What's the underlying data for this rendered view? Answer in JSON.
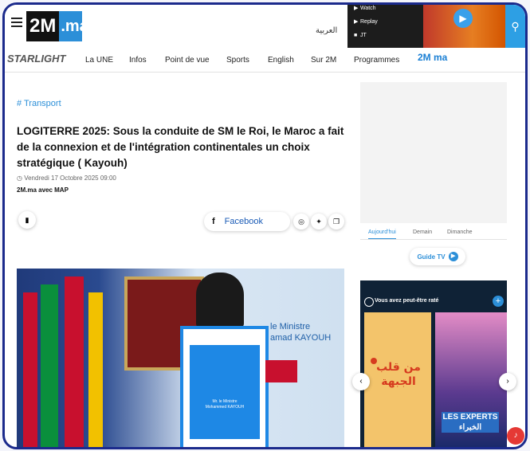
{
  "header": {
    "logo_two": "2M",
    "logo_ma": ".ma",
    "arabic_label": "العربية",
    "live_items": [
      {
        "icon": "play-icon",
        "label": "Watch"
      },
      {
        "icon": "play-icon",
        "label": "Replay"
      },
      {
        "icon": "square-icon",
        "label": "JT"
      }
    ]
  },
  "nav": {
    "starlight": "STARLIGHT",
    "items": [
      "La UNE",
      "Infos",
      "Point de vue",
      "Sports",
      "English",
      "Sur 2M",
      "Programmes"
    ],
    "tv_logo": "2M ma"
  },
  "article": {
    "tag": "# Transport",
    "headline": "LOGITERRE 2025: Sous la conduite de SM le Roi, le Maroc a fait de la connexion et de l'intégration continentales un choix stratégique ( Kayouh)",
    "date": "Vendredi 17 Octobre 2025 09:00",
    "author": "2M.ma avec MAP",
    "facebook_label": "Facebook",
    "photo_banner_lines": [
      "le Ministre",
      "amad KAYOUH"
    ],
    "podium_lines": [
      "Mr. le Ministre",
      "Mohammed KAYOUH"
    ]
  },
  "sidebar": {
    "tabs": [
      "Aujourd'hui",
      "Demain",
      "Dimanche"
    ],
    "guide_tv": "Guide TV",
    "reco_title": "Vous avez peut-être raté",
    "card1_title": "من قلب الجبهة",
    "card2_title": "LES EXPERTS الخبراء"
  },
  "colors": {
    "frame": "#1b2a8c",
    "accent": "#2c8fd8",
    "reco_bg": "#0f2236"
  }
}
